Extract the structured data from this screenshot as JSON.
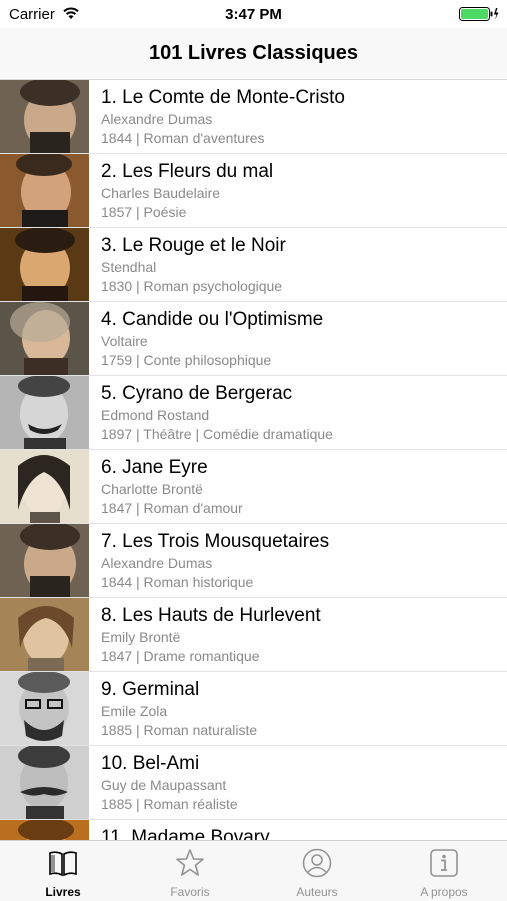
{
  "status_bar": {
    "carrier": "Carrier",
    "time": "3:47 PM"
  },
  "nav": {
    "title": "101 Livres Classiques"
  },
  "books": [
    {
      "title": "1. Le Comte de Monte-Cristo",
      "author": "Alexandre Dumas",
      "meta": "1844 | Roman d'aventures"
    },
    {
      "title": "2. Les Fleurs du mal",
      "author": "Charles Baudelaire",
      "meta": "1857 | Poésie"
    },
    {
      "title": "3. Le Rouge et le Noir",
      "author": "Stendhal",
      "meta": "1830 | Roman psychologique"
    },
    {
      "title": "4. Candide ou l'Optimisme",
      "author": "Voltaire",
      "meta": "1759 | Conte philosophique"
    },
    {
      "title": "5. Cyrano de Bergerac",
      "author": "Edmond Rostand",
      "meta": "1897 | Théâtre | Comédie dramatique"
    },
    {
      "title": "6. Jane Eyre",
      "author": "Charlotte Brontë",
      "meta": "1847 | Roman d'amour"
    },
    {
      "title": "7. Les Trois Mousquetaires",
      "author": "Alexandre Dumas",
      "meta": "1844 | Roman historique"
    },
    {
      "title": "8. Les Hauts de Hurlevent",
      "author": "Emily Brontë",
      "meta": "1847 | Drame romantique"
    },
    {
      "title": "9. Germinal",
      "author": "Emile Zola",
      "meta": "1885 | Roman naturaliste"
    },
    {
      "title": "10. Bel-Ami",
      "author": "Guy de Maupassant",
      "meta": "1885 | Roman réaliste"
    },
    {
      "title": "11. Madame Bovary",
      "author": "",
      "meta": ""
    }
  ],
  "tabs": [
    {
      "label": "Livres",
      "icon": "book-icon",
      "active": true
    },
    {
      "label": "Favoris",
      "icon": "star-icon",
      "active": false
    },
    {
      "label": "Auteurs",
      "icon": "person-icon",
      "active": false
    },
    {
      "label": "A propos",
      "icon": "info-icon",
      "active": false
    }
  ],
  "colors": {
    "tab_active": "#000000",
    "tab_inactive": "#929292",
    "subtitle": "#8a8a8a",
    "battery": "#4cd964"
  }
}
